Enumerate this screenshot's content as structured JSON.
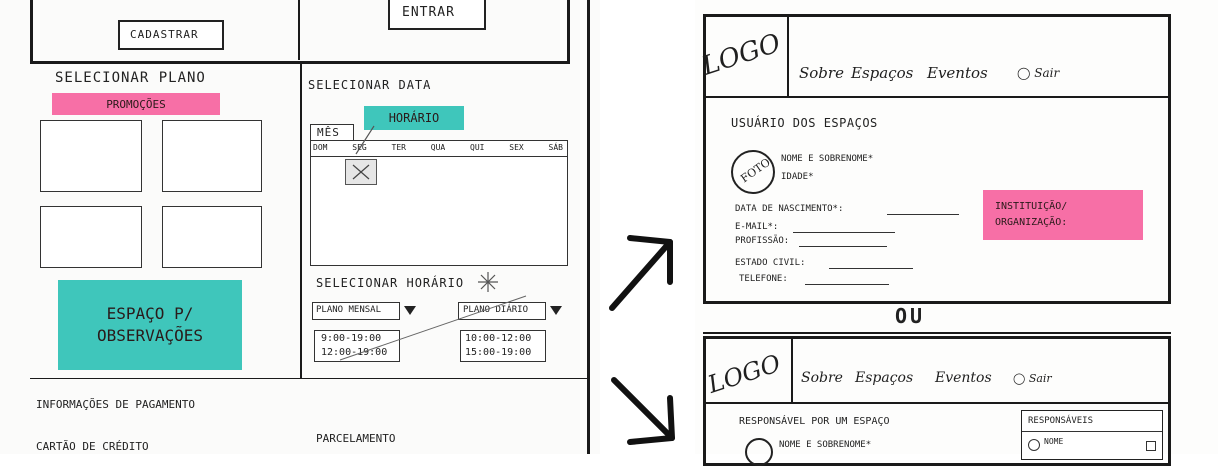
{
  "left_sketch": {
    "top_buttons": {
      "register": "CADASTRAR",
      "login": "ENTRAR"
    },
    "plan": {
      "title": "SELECIONAR PLANO",
      "promo_label": "PROMOÇÕES"
    },
    "date": {
      "title": "SELECIONAR DATA",
      "hour_note": "HORÁRIO",
      "month_tab": "MÊS",
      "weekdays": [
        "DOM",
        "SEG",
        "TER",
        "QUA",
        "QUI",
        "SEX",
        "SÁB"
      ]
    },
    "observations_note": {
      "line1": "ESPAÇO P/",
      "line2": "OBSERVAÇÕES"
    },
    "time": {
      "title": "SELECIONAR HORÁRIO",
      "monthly_plan": "PLANO MENSAL",
      "daily_plan": "PLANO DIÁRIO",
      "monthly_slots": [
        "9:00-19:00",
        "12:00-19:00"
      ],
      "daily_slots": [
        "10:00-12:00",
        "15:00-19:00"
      ]
    },
    "payment": {
      "title": "INFORMAÇÕES DE PAGAMENTO",
      "credit_card": "CARTÃO DE CRÉDITO",
      "installments": "PARCELAMENTO"
    }
  },
  "right_sketch": {
    "screen_a": {
      "logo": "LOGO",
      "nav": [
        "Sobre",
        "Espaços",
        "Eventos"
      ],
      "logout": "Sair",
      "section_title": "USUÁRIO DOS ESPAÇOS",
      "photo": "FOTO",
      "name_label": "NOME E SOBRENOME*",
      "age_label": "IDADE*",
      "fields": [
        "DATA DE NASCIMENTO*:",
        "E-MAIL*:",
        "PROFISSÃO:",
        "ESTADO CIVIL:",
        "TELEFONE:"
      ],
      "institution_note": {
        "line1": "INSTITUIÇÃO/",
        "line2": "ORGANIZAÇÃO:"
      }
    },
    "divider_label": "OU",
    "screen_b": {
      "logo": "LOGO",
      "nav": [
        "Sobre",
        "Espaços",
        "Eventos"
      ],
      "logout": "Sair",
      "section_title": "RESPONSÁVEL POR UM ESPAÇO",
      "name_label": "NOME E SOBRENOME*",
      "responsibles_title": "RESPONSÁVEIS",
      "responsible_item": "NOME"
    }
  },
  "colors": {
    "pink_note": "#f76fa6",
    "teal_note": "#3fc6bb",
    "ink": "#1a1a1a"
  }
}
